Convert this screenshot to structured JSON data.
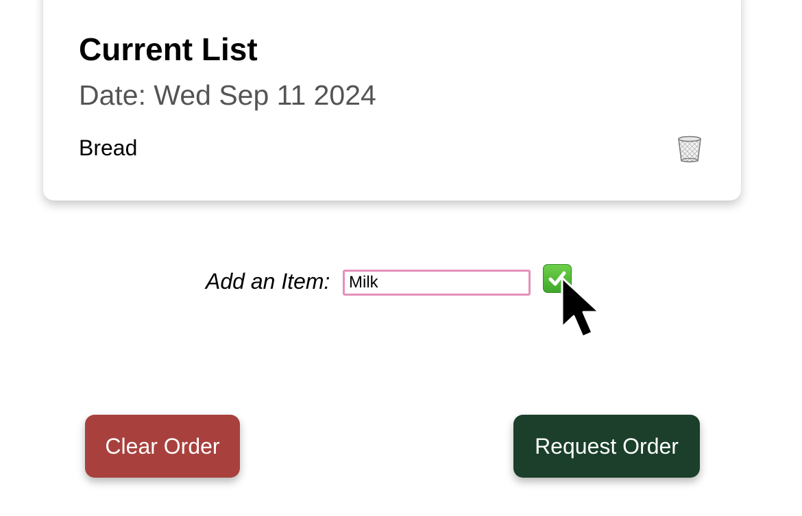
{
  "current_list": {
    "title": "Current List",
    "date_label": "Date: Wed Sep 11 2024",
    "items": [
      {
        "name": "Bread",
        "delete_icon": "trash-can-icon"
      }
    ]
  },
  "add_item": {
    "label": "Add an Item:",
    "input_value": "Milk",
    "submit_icon": "green-check-icon"
  },
  "actions": {
    "clear_label": "Clear Order",
    "request_label": "Request Order"
  },
  "colors": {
    "clear_button": "#a8413d",
    "request_button": "#1b3f2b",
    "input_border": "#e58fb8",
    "check_green": "#4cb832",
    "date_text": "#545454"
  }
}
